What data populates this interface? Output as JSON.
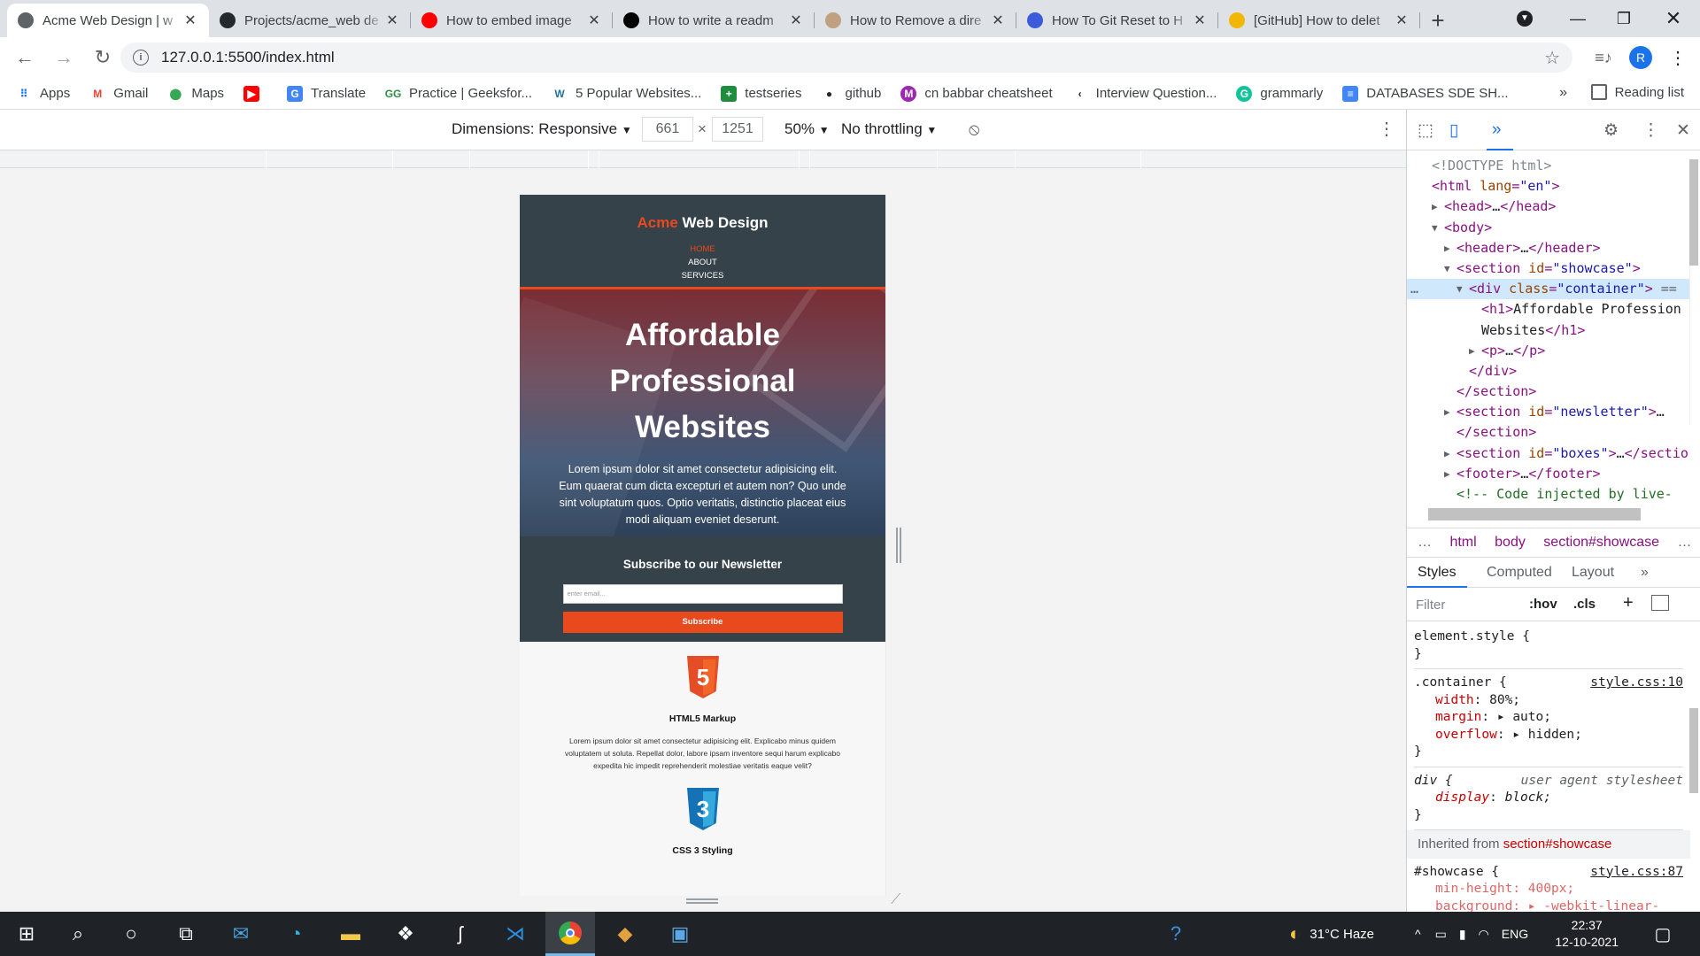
{
  "browser": {
    "tabs": [
      {
        "label": "Acme Web Design | w",
        "icon": "globe-icon",
        "color": "#5f6368",
        "active": true
      },
      {
        "label": "Projects/acme_web de",
        "icon": "github-icon",
        "color": "#24292e"
      },
      {
        "label": "How to embed image",
        "icon": "youtube-icon",
        "color": "#ff0000"
      },
      {
        "label": "How to write a readm",
        "icon": "medium-icon",
        "color": "#000000"
      },
      {
        "label": "How to Remove a dire",
        "icon": "site-icon",
        "color": "#c0a080"
      },
      {
        "label": "How To Git Reset to H",
        "icon": "bookmark-icon",
        "color": "#3b5bdb"
      },
      {
        "label": "[GitHub] How to delet",
        "icon": "doc-icon",
        "color": "#f2b705"
      }
    ],
    "url": "127.0.0.1:5500/index.html",
    "profile_initial": "R",
    "bookmarks": [
      {
        "label": "Apps",
        "icon": "apps-grid-icon"
      },
      {
        "label": "Gmail",
        "icon": "gmail-icon"
      },
      {
        "label": "Maps",
        "icon": "maps-icon"
      },
      {
        "label": "",
        "icon": "youtube-icon"
      },
      {
        "label": "Translate",
        "icon": "translate-icon"
      },
      {
        "label": "Practice | Geeksfor...",
        "icon": "geeksforgeeks-icon"
      },
      {
        "label": "5 Popular Websites...",
        "icon": "wordpress-icon"
      },
      {
        "label": "testseries",
        "icon": "plus-green-icon"
      },
      {
        "label": "github",
        "icon": "github-icon"
      },
      {
        "label": "cn babbar cheatsheet",
        "icon": "m-purple-icon"
      },
      {
        "label": "Interview Question...",
        "icon": "arrow-logo-icon"
      },
      {
        "label": "grammarly",
        "icon": "grammarly-icon"
      },
      {
        "label": "DATABASES SDE SH...",
        "icon": "docs-icon"
      }
    ],
    "bookmarks_more": "»",
    "reading_list": "Reading list"
  },
  "device_toolbar": {
    "dimensions_label": "Dimensions: Responsive",
    "width": "661",
    "times": "×",
    "height": "1251",
    "zoom": "50%",
    "throttling": "No throttling"
  },
  "site": {
    "brand_highlight": "Acme",
    "brand_rest": " Web Design",
    "nav": [
      "HOME",
      "ABOUT",
      "SERVICES"
    ],
    "showcase_title_lines": [
      "Affordable",
      "Professional",
      "Websites"
    ],
    "showcase_text": "Lorem ipsum dolor sit amet consectetur adipisicing elit. Eum quaerat cum dicta excepturi et autem non? Quo unde sint voluptatum quos. Optio veritatis, distinctio placeat eius modi aliquam eveniet deserunt.",
    "newsletter_title": "Subscribe to our Newsletter",
    "newsletter_placeholder": "enter email...",
    "newsletter_button": "Subscribe",
    "boxes": [
      {
        "icon_text": "5",
        "title": "HTML5 Markup",
        "text": "Lorem ipsum dolor sit amet consectetur adipisicing elit. Explicabo minus quidem voluptatem ut soluta. Repellat dolor, labore ipsam inventore sequi harum explicabo expedita hic impedit reprehenderit molestiae veritatis eaque velit?"
      },
      {
        "icon_text": "3",
        "title": "CSS 3 Styling",
        "text": ""
      }
    ]
  },
  "devtools": {
    "dom_lines": [
      {
        "indent": 0,
        "html": "<!DOCTYPE html>",
        "kind": "doctype"
      },
      {
        "indent": 0,
        "tag": "html",
        "attr": "lang",
        "val": "\"en\"",
        "open": true
      },
      {
        "indent": 1,
        "tag": "head",
        "collapsed": "…</head>",
        "arrow": "right"
      },
      {
        "indent": 1,
        "tag": "body",
        "arrow": "down"
      },
      {
        "indent": 2,
        "tag": "header",
        "collapsed": "…</header>",
        "arrow": "right"
      },
      {
        "indent": 2,
        "tag": "section",
        "attr": "id",
        "val": "\"showcase\"",
        "arrow": "down"
      },
      {
        "indent": 3,
        "tag": "div",
        "attr": "class",
        "val": "\"container\"",
        "arrow": "down",
        "selected": true,
        "suffix": " =="
      },
      {
        "indent": 4,
        "text": "<h1>Affordable Profession"
      },
      {
        "indent": 4,
        "text": "Websites</h1>"
      },
      {
        "indent": 4,
        "tag": "p",
        "collapsed": "…</p>",
        "arrow": "right"
      },
      {
        "indent": 3,
        "text": "</div>"
      },
      {
        "indent": 2,
        "text": "</section>"
      },
      {
        "indent": 2,
        "tag": "section",
        "attr": "id",
        "val": "\"newsletter\"",
        "collapsed": "…",
        "arrow": "right"
      },
      {
        "indent": 2,
        "text": "</section>"
      },
      {
        "indent": 2,
        "tag": "section",
        "attr": "id",
        "val": "\"boxes\"",
        "collapsed": "…</sectio",
        "arrow": "right"
      },
      {
        "indent": 2,
        "tag": "footer",
        "collapsed": "…</footer>",
        "arrow": "right"
      },
      {
        "indent": 2,
        "comment": "<!-- Code injected by live-"
      }
    ],
    "breadcrumbs": [
      "html",
      "body",
      "section#showcase"
    ],
    "breadcrumbs_ellipsis": "…",
    "pane_tabs": [
      "Styles",
      "Computed",
      "Layout"
    ],
    "filter_placeholder": "Filter",
    "hov": ":hov",
    "cls": ".cls",
    "rules": [
      {
        "selector": "element.style {",
        "source": "",
        "props": [],
        "close": "}"
      },
      {
        "selector": ".container {",
        "source": "style.css:10",
        "props": [
          {
            "name": "width",
            "value": " 80%;"
          },
          {
            "name": "margin",
            "value": " ▸ auto;"
          },
          {
            "name": "overflow",
            "value": " ▸ hidden;"
          }
        ],
        "close": "}"
      },
      {
        "selector": "div {",
        "source": "user agent stylesheet",
        "ua": true,
        "props": [
          {
            "name": "display",
            "value": " block;"
          }
        ],
        "close": "}"
      }
    ],
    "inherited_label": "Inherited from",
    "inherited_from": "section#showcase",
    "showcase_rule": {
      "selector": "#showcase {",
      "source": "style.css:87",
      "props": [
        {
          "name": "min-height",
          "value": " 400px;"
        },
        {
          "name": "background",
          "value": " ▸ -webkit-linear-"
        }
      ]
    }
  },
  "taskbar": {
    "weather": "31°C  Haze",
    "lang": "ENG",
    "time": "22:37",
    "date": "12-10-2021"
  }
}
